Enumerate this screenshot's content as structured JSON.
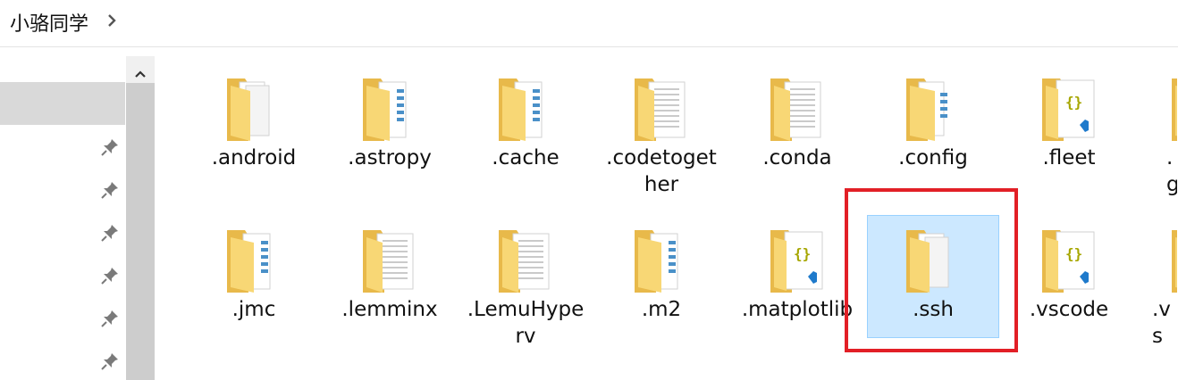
{
  "breadcrumb": {
    "current": "小骆同学"
  },
  "nav": {
    "pinned_count": 6
  },
  "files": {
    "row1": [
      {
        "name": ".android",
        "icon": "folder-docs-icon"
      },
      {
        "name": ".astropy",
        "icon": "folder-media-icon"
      },
      {
        "name": ".cache",
        "icon": "folder-media-icon"
      },
      {
        "name": ".codetogether",
        "icon": "folder-text-icon"
      },
      {
        "name": ".conda",
        "icon": "folder-text-icon"
      },
      {
        "name": ".config",
        "icon": "folder-docs-icon"
      },
      {
        "name": ".fleet",
        "icon": "vscode-json-file-icon"
      },
      {
        "name": ".g",
        "icon": "folder-icon"
      }
    ],
    "row2": [
      {
        "name": ".jmc",
        "icon": "folder-media-icon"
      },
      {
        "name": ".lemminx",
        "icon": "folder-text-icon"
      },
      {
        "name": ".LemuHyperv",
        "icon": "folder-text-icon"
      },
      {
        "name": ".m2",
        "icon": "folder-media-icon"
      },
      {
        "name": ".matplotlib",
        "icon": "vscode-json-file-icon"
      },
      {
        "name": ".ssh",
        "icon": "folder-docs-icon",
        "selected": true
      },
      {
        "name": ".vscode",
        "icon": "vscode-json-file-icon"
      },
      {
        "name": ".vs",
        "icon": "folder-icon"
      }
    ]
  },
  "colors": {
    "selection_bg": "#cce8ff",
    "selection_border": "#99d1ff",
    "annotation_red": "#e21f26",
    "folder_yellow": "#f8d775"
  }
}
